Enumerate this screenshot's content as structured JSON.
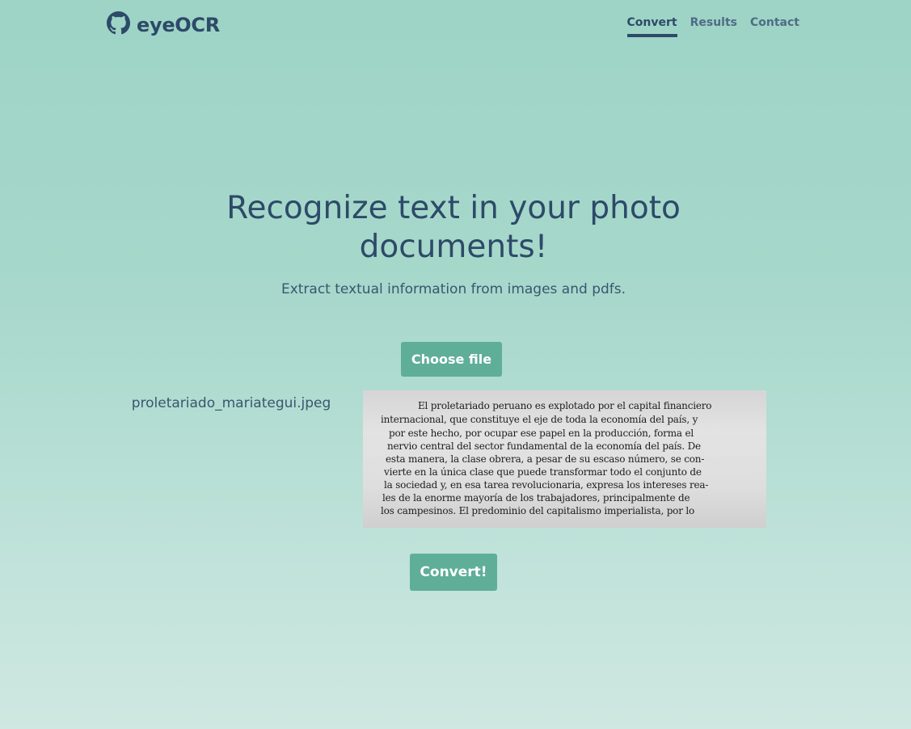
{
  "brand": {
    "name": "eyeOCR",
    "icon": "github-icon"
  },
  "nav": [
    {
      "label": "Convert",
      "active": true
    },
    {
      "label": "Results",
      "active": false
    },
    {
      "label": "Contact",
      "active": false
    }
  ],
  "hero": {
    "title_line1": "Recognize text in your photo",
    "title_line2": "documents!",
    "subtitle": "Extract textual information from images and pdfs."
  },
  "upload": {
    "choose_label": "Choose file",
    "file_name": "proletariado_mariategui.jpeg",
    "convert_label": "Convert!"
  },
  "preview_lines": [
    "El proletariado peruano es explotado por el capital financiero",
    "internacional, que constituye el eje de toda la economía del país, y",
    "por este hecho, por ocupar ese papel en la producción, forma el",
    "nervio central del sector fundamental de la economía del país. De",
    "esta manera, la clase obrera, a pesar de su escaso número, se con-",
    "vierte en la única clase que puede transformar todo el conjunto de",
    "la sociedad y, en esa tarea revolucionaria, expresa los intereses rea-",
    "les de la enorme mayoría de los trabajadores, principalmente de",
    "los campesinos. El predominio del capitalismo imperialista, por lo"
  ],
  "colors": {
    "accent": "#5fae98",
    "heading": "#2d4a68",
    "background_top": "#9dd4c6",
    "background_bottom": "#cfe8e1"
  }
}
